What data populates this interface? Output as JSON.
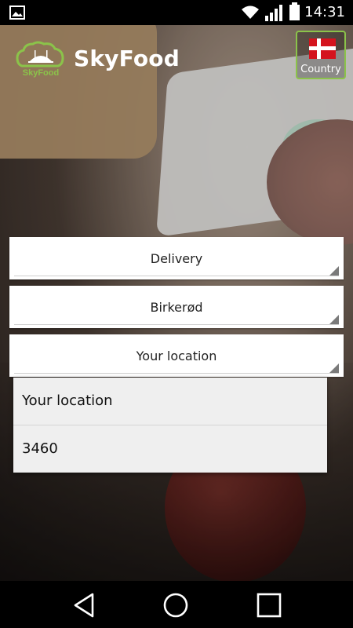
{
  "status_bar": {
    "time": "14:31",
    "icons": [
      "image-icon",
      "wifi-icon",
      "signal-icon",
      "battery-icon"
    ]
  },
  "header": {
    "logo_text": "SkyFood",
    "brand": "SkyFood",
    "country_label": "Country"
  },
  "dropdowns": [
    {
      "value": "Delivery"
    },
    {
      "value": "Birkerød"
    },
    {
      "value": "Your location"
    }
  ],
  "popup": {
    "options": [
      "Your location",
      "3460"
    ]
  },
  "nav": [
    "back-icon",
    "home-icon",
    "recents-icon"
  ],
  "colors": {
    "accent": "#8bc34a",
    "danish_red": "#d4131d"
  }
}
